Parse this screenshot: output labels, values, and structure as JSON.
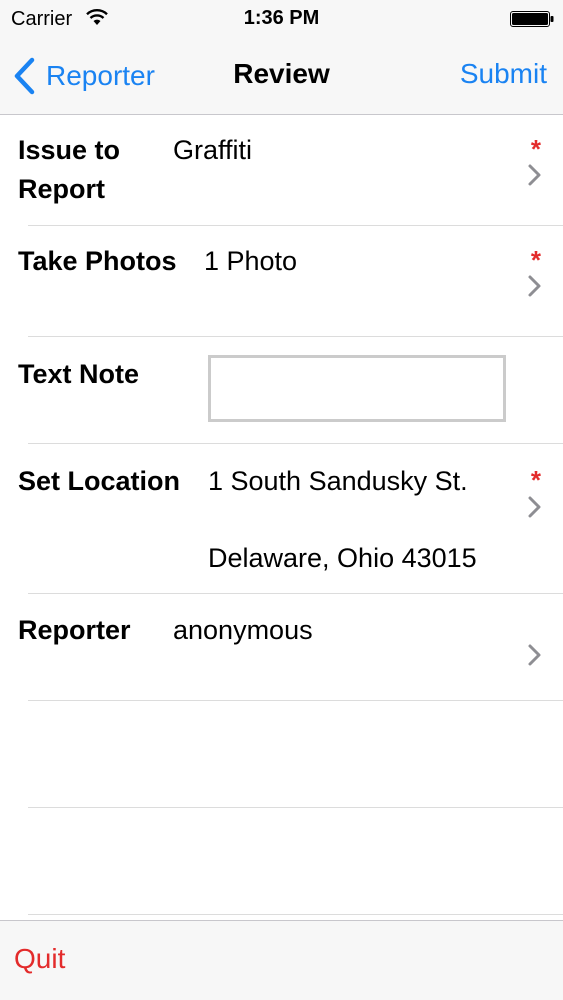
{
  "status_bar": {
    "carrier": "Carrier",
    "time": "1:36 PM",
    "wifi_icon": "wifi-icon",
    "battery_icon": "battery-icon"
  },
  "nav": {
    "back_label": "Reporter",
    "title": "Review",
    "submit_label": "Submit"
  },
  "form": {
    "issue": {
      "label_line1": "Issue to",
      "label_line2": "Report",
      "value": "Graffiti",
      "required_mark": "*"
    },
    "photos": {
      "label": "Take Photos",
      "value": "1 Photo",
      "required_mark": "*"
    },
    "note": {
      "label": "Text Note",
      "value": ""
    },
    "location": {
      "label": "Set Location",
      "value_line1": "1 South Sandusky St.",
      "value_line2": "Delaware, Ohio 43015",
      "required_mark": "*"
    },
    "reporter": {
      "label": "Reporter",
      "value": "anonymous"
    }
  },
  "toolbar": {
    "quit_label": "Quit"
  },
  "colors": {
    "accent_blue": "#1a83f2",
    "required_red": "#e32b2b",
    "quit_red": "#e32b2b",
    "bar_background": "#f7f7f7"
  }
}
